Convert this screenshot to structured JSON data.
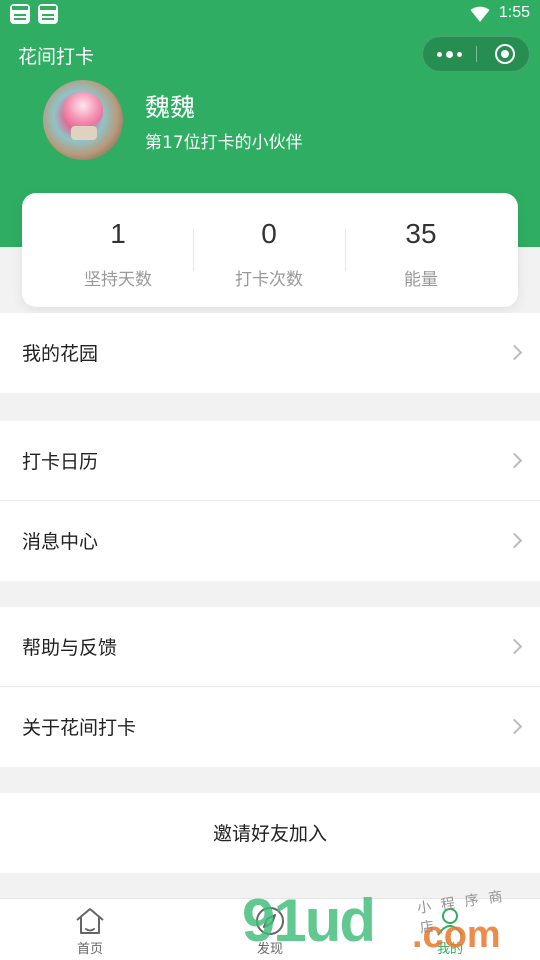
{
  "status_bar": {
    "time": "1:55"
  },
  "header": {
    "app_title": "花间打卡",
    "username": "魏魏",
    "subtitle": "第17位打卡的小伙伴"
  },
  "stats": [
    {
      "value": "1",
      "label": "坚持天数"
    },
    {
      "value": "0",
      "label": "打卡次数"
    },
    {
      "value": "35",
      "label": "能量"
    }
  ],
  "menu": {
    "garden": "我的花园",
    "calendar": "打卡日历",
    "messages": "消息中心",
    "help": "帮助与反馈",
    "about": "关于花间打卡",
    "invite": "邀请好友加入"
  },
  "tab_bar": {
    "items": [
      {
        "label": "首页",
        "icon": "home-icon"
      },
      {
        "label": "发现",
        "icon": "compass-icon"
      },
      {
        "label": "我的",
        "icon": "person-icon"
      }
    ],
    "active_index": 2
  },
  "watermark": {
    "big": "91ud",
    "com": ".com",
    "small": "小程序商店"
  },
  "colors": {
    "accent": "#2fae63",
    "background": "#f2f2f2"
  }
}
